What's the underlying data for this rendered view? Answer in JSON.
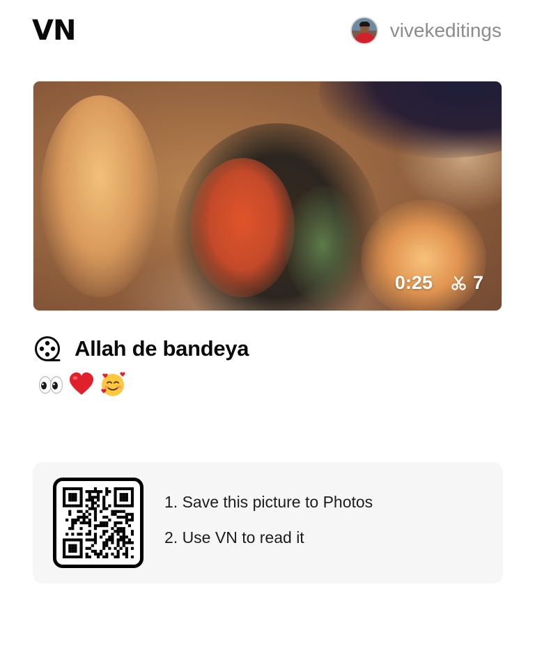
{
  "header": {
    "logo": "VN",
    "username": "vivekeditings",
    "avatar_icon": "user-avatar"
  },
  "video": {
    "duration": "0:25",
    "clip_count": "7",
    "clip_icon": "scissors-icon"
  },
  "project": {
    "title": "Allah de bandeya",
    "title_icon": "film-reel-icon",
    "description_emojis": [
      "eyes-emoji",
      "red-heart-emoji",
      "smiling-face-with-hearts-emoji"
    ]
  },
  "qr_card": {
    "qr_icon": "qr-code-icon",
    "steps": [
      "1. Save this picture to Photos",
      "2. Use VN to read it"
    ],
    "background": "#f6f6f6"
  },
  "colors": {
    "text_primary": "#0a0a0a",
    "text_muted": "#8c8c8c",
    "card_bg": "#f6f6f6"
  }
}
